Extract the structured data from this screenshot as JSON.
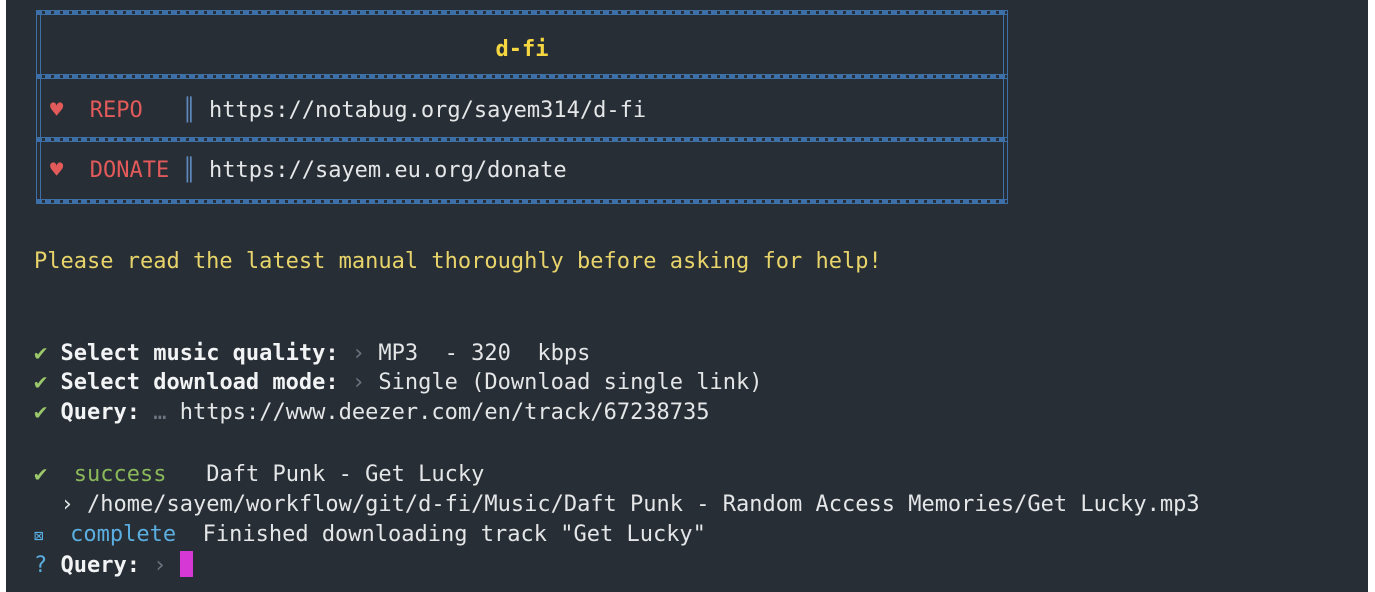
{
  "banner": {
    "title": "d-fi",
    "repo_label": "REPO",
    "repo_url": "https://notabug.org/sayem314/d-fi",
    "donate_label": "DONATE",
    "donate_url": "https://sayem.eu.org/donate",
    "heart_icon": "♥",
    "separator": "║"
  },
  "notice": "Please read the latest manual thoroughly before asking for help!",
  "prompts": [
    {
      "check": "✔",
      "label": "Select music quality:",
      "arrow": "›",
      "value": "MP3  - 320  kbps"
    },
    {
      "check": "✔",
      "label": "Select download mode:",
      "arrow": "›",
      "value": "Single (Download single link)"
    },
    {
      "check": "✔",
      "label": "Query:",
      "arrow": "…",
      "value": "https://www.deezer.com/en/track/67238735"
    }
  ],
  "success": {
    "icon": "✔",
    "status": "success",
    "message": "Daft Punk - Get Lucky",
    "path_arrow": "›",
    "path": "/home/sayem/workflow/git/d-fi/Music/Daft Punk - Random Access Memories/Get Lucky.mp3"
  },
  "complete": {
    "icon": "⊠",
    "status": "complete",
    "message": "Finished downloading track \"Get Lucky\""
  },
  "input_prompt": {
    "icon": "?",
    "label": "Query:",
    "arrow": "›",
    "value": ""
  },
  "colors": {
    "background": "#272e35",
    "accent_yellow": "#f5d742",
    "red": "#e35a5a",
    "green": "#8ab85a",
    "cyan": "#5aaee0",
    "cursor": "#d638d6"
  }
}
